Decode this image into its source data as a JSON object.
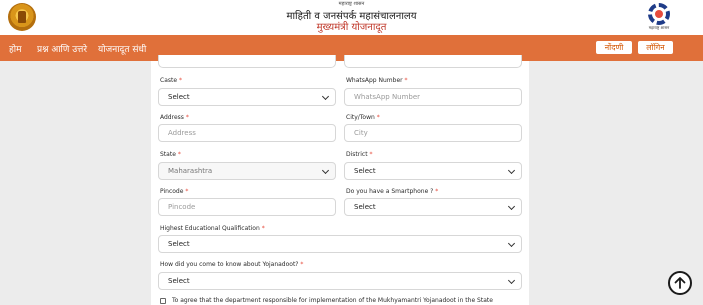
{
  "header": {
    "dept_small": "महाराष्ट्र शासन",
    "department": "माहिती व जनसंपर्क महासंचालनालय",
    "scheme": "मुख्यमंत्री योजनादूत",
    "right_logo_caption": "महाराष्ट्र शासन"
  },
  "nav": {
    "items": [
      "होम",
      "प्रश्न आणि उत्तरे",
      "योजनादूत संधी"
    ],
    "register_label": "नोंदणी",
    "login_label": "लॉगिन"
  },
  "form": {
    "caste": {
      "label": "Caste",
      "value": "Select"
    },
    "whatsapp": {
      "label": "WhatsApp Number",
      "placeholder": "WhatsApp Number"
    },
    "address": {
      "label": "Address",
      "placeholder": "Address"
    },
    "city": {
      "label": "City/Town",
      "placeholder": "City"
    },
    "state": {
      "label": "State",
      "value": "Maharashtra"
    },
    "district": {
      "label": "District",
      "value": "Select"
    },
    "pincode": {
      "label": "Pincode",
      "placeholder": "Pincode"
    },
    "smartphone": {
      "label": "Do you have a Smartphone ?",
      "value": "Select"
    },
    "education": {
      "label": "Highest Educational Qualification",
      "value": "Select"
    },
    "source": {
      "label": "How did you come to know about Yojanadoot?",
      "value": "Select"
    },
    "required_marker": "*",
    "consent": "To agree that the department responsible for implementation of the Mukhyamantri Yojanadoot in the State"
  },
  "icons": [
    "maharashtra-emblem-icon",
    "dgipr-gear-logo-icon",
    "chevron-down-icon",
    "arrow-up-circle-icon"
  ],
  "colors": {
    "navbar": "#e0703a",
    "scheme_title": "#c0392b",
    "required": "#e74c3c"
  }
}
